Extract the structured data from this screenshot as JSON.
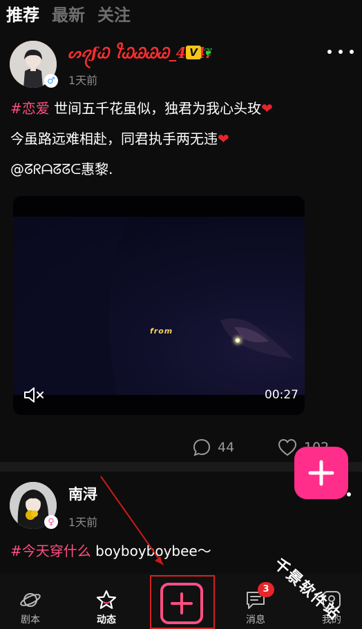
{
  "top_tabs": [
    {
      "label": "推荐",
      "active": true
    },
    {
      "label": "最新",
      "active": false
    },
    {
      "label": "关注",
      "active": false
    }
  ],
  "posts": [
    {
      "user_name": "ᔕꪖƒᏇ ꪻᏇᏊᏊᏊ_404.",
      "vip_label": "V",
      "gender": "male",
      "time": "1天前",
      "lines": [
        {
          "tag": "#恋爱",
          "text": " 世间五千花虽似，独君为我心头玫",
          "heart": "❤"
        },
        {
          "tag": "",
          "text": "今虽路远难相赴，同君执手两无违",
          "heart": "❤"
        },
        {
          "tag": "",
          "text": "@ᘔᖇᗩᘔᘔᕮ惠黎.",
          "heart": ""
        }
      ],
      "video": {
        "caption": "from",
        "duration": "00:27"
      },
      "comments": "44",
      "likes": "102"
    },
    {
      "user_name": "南浔",
      "gender": "female",
      "time": "1天前",
      "lines": [
        {
          "tag": "#今天穿什么",
          "text": " boyboyboybee～",
          "heart": ""
        }
      ]
    }
  ],
  "bottom_nav": [
    {
      "label": "剧本",
      "icon": "planet-icon",
      "active": false
    },
    {
      "label": "动态",
      "icon": "star-icon",
      "active": true
    },
    {
      "label": "",
      "icon": "plus-icon",
      "active": false
    },
    {
      "label": "消息",
      "icon": "chat-icon",
      "active": false,
      "badge": "3"
    },
    {
      "label": "我的",
      "icon": "profile-icon",
      "active": false
    }
  ],
  "watermark": "千景软件站",
  "colors": {
    "accent": "#ff2e8a",
    "tag": "#ff4f82",
    "name_red": "#ff2e2e",
    "background": "#0d0d0d"
  }
}
